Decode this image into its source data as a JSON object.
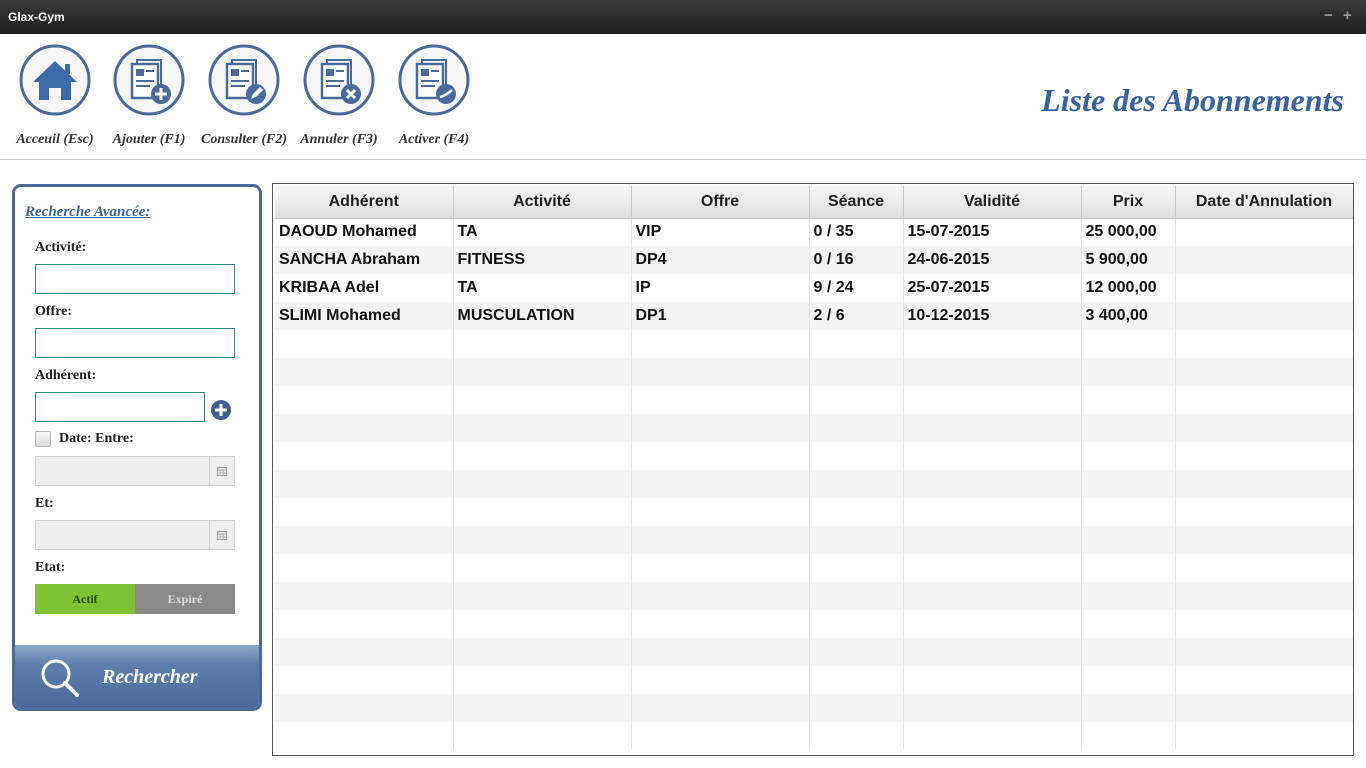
{
  "window": {
    "title": "Glax-Gym",
    "minimize_icon": "−",
    "maximize_icon": "+"
  },
  "toolbar": {
    "buttons": [
      {
        "label": "Acceuil (Esc)",
        "icon": "home-icon"
      },
      {
        "label": "Ajouter (F1)",
        "icon": "document-add-icon"
      },
      {
        "label": "Consulter (F2)",
        "icon": "document-edit-icon"
      },
      {
        "label": "Annuler (F3)",
        "icon": "document-cancel-icon"
      },
      {
        "label": "Activer (F4)",
        "icon": "document-activate-icon"
      }
    ],
    "page_title": "Liste des Abonnements"
  },
  "search": {
    "title": "Recherche Avancée:",
    "activite_label": "Activité:",
    "activite_value": "",
    "offre_label": "Offre:",
    "offre_value": "",
    "adherent_label": "Adhérent:",
    "adherent_value": "",
    "date_checkbox_label": "Date: Entre:",
    "date_checked": false,
    "date_from": "",
    "et_label": "Et:",
    "date_to": "",
    "etat_label": "Etat:",
    "etat_actif": "Actif",
    "etat_expire": "Expiré",
    "search_button": "Rechercher"
  },
  "table": {
    "columns": [
      "Adhérent",
      "Activité",
      "Offre",
      "Séance",
      "Validité",
      "Prix",
      "Date d'Annulation"
    ],
    "rows": [
      [
        "DAOUD Mohamed",
        "TA",
        "VIP",
        "0 / 35",
        "15-07-2015",
        "25 000,00",
        ""
      ],
      [
        "SANCHA Abraham",
        "FITNESS",
        "DP4",
        "0 / 16",
        "24-06-2015",
        "5 900,00",
        ""
      ],
      [
        "KRIBAA Adel",
        "TA",
        "IP",
        "9 / 24",
        "25-07-2015",
        "12 000,00",
        ""
      ],
      [
        "SLIMI Mohamed",
        "MUSCULATION",
        "DP1",
        "2 / 6",
        "10-12-2015",
        "3 400,00",
        ""
      ]
    ],
    "empty_rows": 15
  },
  "colors": {
    "accent": "#3b62a0",
    "panel_border": "#4a6b9a",
    "actif": "#7ec133",
    "expire": "#8a8a8a"
  }
}
